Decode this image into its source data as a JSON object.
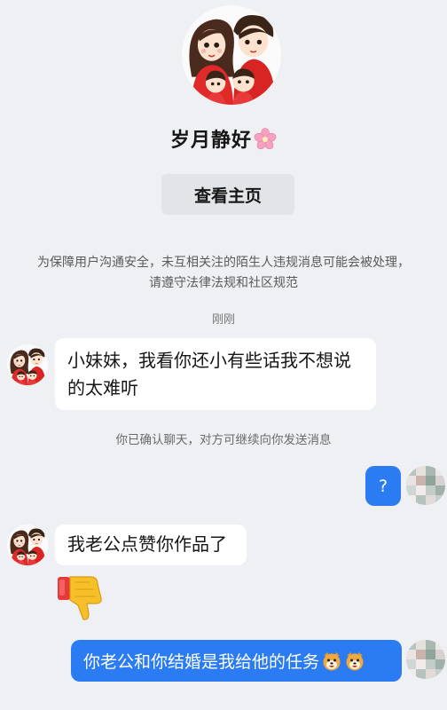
{
  "profile": {
    "name": "岁月静好",
    "view_homepage_label": "查看主页"
  },
  "notice": {
    "safety_text": "为保障用户沟通安全，未互相关注的陌生人违规消息可能会被处理，请遵守法律法规和社区规范",
    "time_label": "刚刚",
    "confirm_text": "你已确认聊天，对方可继续向你发送消息"
  },
  "messages": [
    {
      "sender": "other",
      "text": "小妹妹，我看你还小有些话我不想说的太难听"
    },
    {
      "sender": "me",
      "text": "?"
    },
    {
      "sender": "other",
      "text": "我老公点赞你作品了"
    },
    {
      "sender": "other",
      "sticker": "thumbs-down"
    },
    {
      "sender": "me",
      "text": "你老公和你结婚是我给他的任务"
    }
  ],
  "icons": {
    "flower": "cherry-blossom-icon",
    "thumbs_down": "thumbs-down-icon",
    "dog_face": "dog-face-icon"
  },
  "colors": {
    "background": "#eef0f3",
    "outgoing_bubble": "#2b7bf2",
    "incoming_bubble": "#ffffff",
    "button_bg": "#e2e4e8"
  }
}
